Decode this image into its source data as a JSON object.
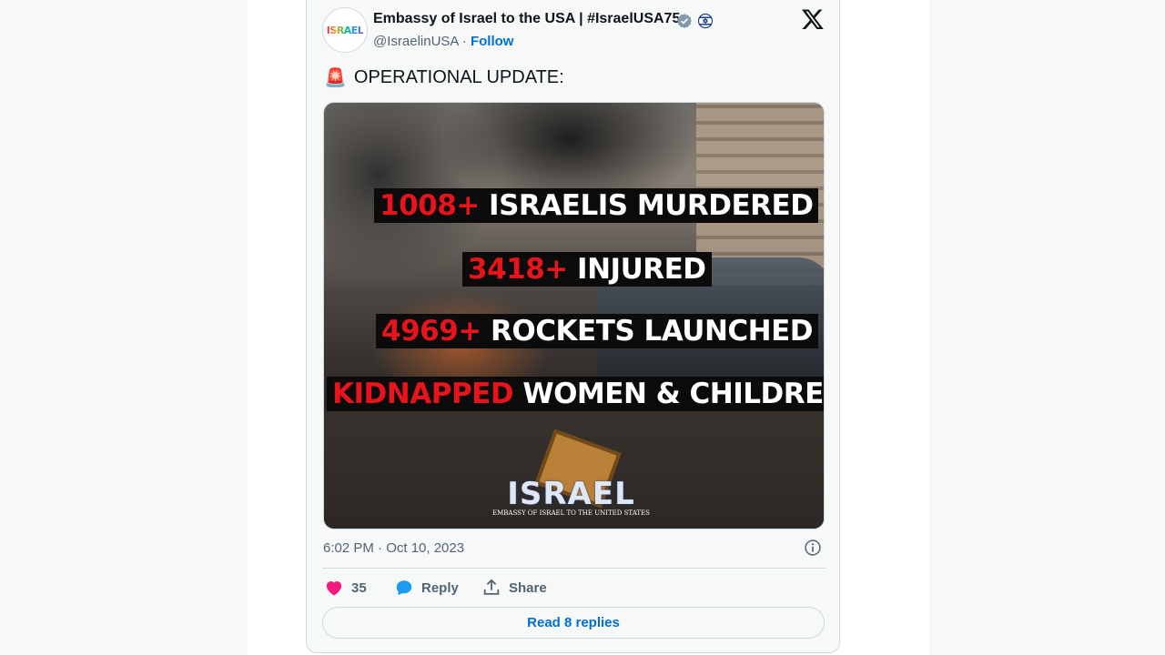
{
  "author": {
    "display_name": "Embassy of Israel to the USA | #IsraelUSA75",
    "handle": "@IsraelinUSA",
    "separator": "·",
    "follow_label": "Follow",
    "avatar_text": "ISRAEL"
  },
  "tweet": {
    "emoji": "🚨",
    "text": "OPERATIONAL UPDATE:"
  },
  "media": {
    "lines": [
      {
        "red": "1008+",
        "white": " ISRAELIS MURDERED"
      },
      {
        "red": "3418+",
        "white": " INJURED"
      },
      {
        "red": "4969+",
        "white": " ROCKETS LAUNCHED"
      },
      {
        "red": "KIDNAPPED",
        "white": " WOMEN & CHILDREN"
      }
    ],
    "watermark_title": "ISRAEL",
    "watermark_subtitle": "EMBASSY OF ISRAEL TO THE UNITED STATES"
  },
  "meta": {
    "timestamp": "6:02 PM · Oct 10, 2023"
  },
  "actions": {
    "like_count": "35",
    "reply_label": "Reply",
    "share_label": "Share"
  },
  "read_replies_label": "Read 8 replies",
  "colors": {
    "link_blue": "#006fd6",
    "like_pink": "#f91880",
    "reply_blue": "#1d9bf0",
    "banner_red": "#e8141b"
  }
}
